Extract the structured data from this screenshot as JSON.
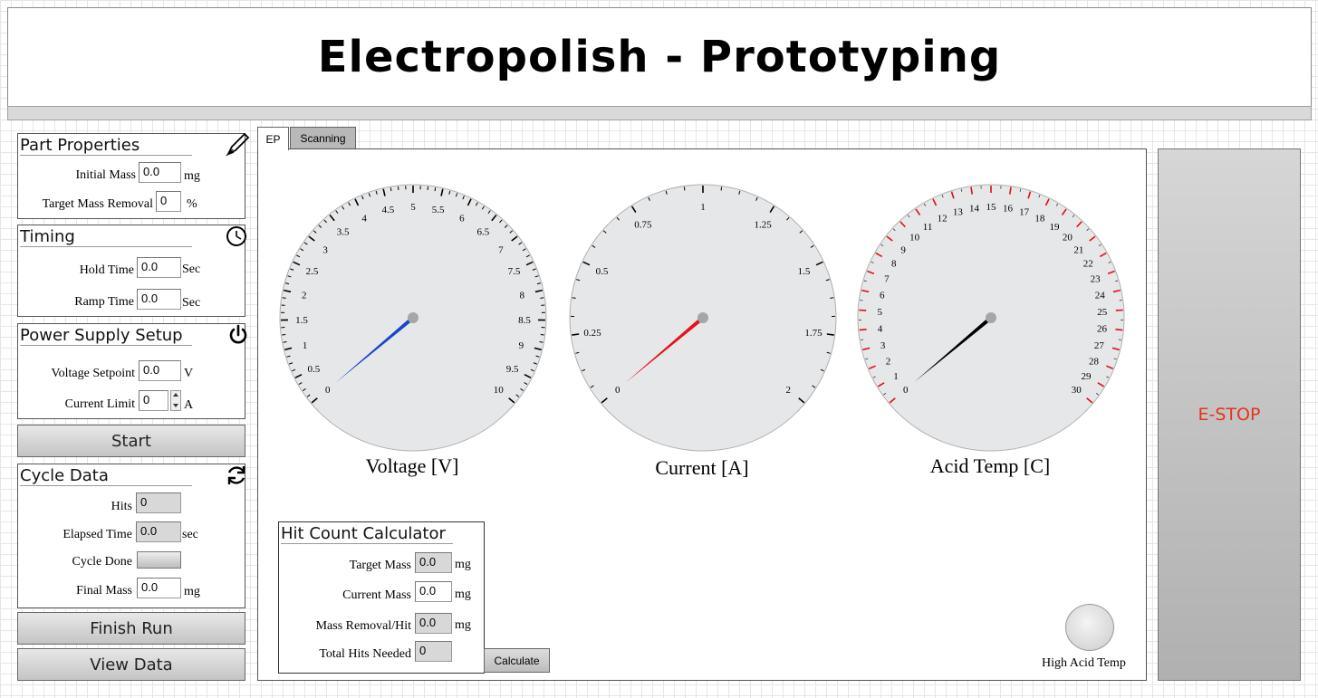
{
  "title": "Electropolish - Prototyping",
  "part_properties": {
    "title": "Part Properties",
    "initial_mass": {
      "label": "Initial Mass",
      "value": "0.0",
      "unit": "mg"
    },
    "target_removal": {
      "label": "Target Mass Removal",
      "value": "0",
      "unit": "%"
    }
  },
  "timing": {
    "title": "Timing",
    "hold_time": {
      "label": "Hold Time",
      "value": "0.0",
      "unit": "Sec"
    },
    "ramp_time": {
      "label": "Ramp Time",
      "value": "0.0",
      "unit": "Sec"
    }
  },
  "power_supply": {
    "title": "Power Supply Setup",
    "voltage": {
      "label": "Voltage Setpoint",
      "value": "0.0",
      "unit": "V"
    },
    "current": {
      "label": "Current Limit",
      "value": "0",
      "unit": "A"
    }
  },
  "start_label": "Start",
  "cycle_data": {
    "title": "Cycle Data",
    "hits": {
      "label": "Hits",
      "value": "0"
    },
    "elapsed": {
      "label": "Elapsed Time",
      "value": "0.0",
      "unit": "sec"
    },
    "cycle_done": {
      "label": "Cycle Done"
    },
    "final_mass": {
      "label": "Final Mass",
      "value": "0.0",
      "unit": "mg"
    }
  },
  "finish_label": "Finish Run",
  "view_label": "View Data",
  "tabs": [
    "EP",
    "Scanning"
  ],
  "gauges": [
    {
      "label": "Voltage [V]",
      "value": 0,
      "needle_color": "#1b45c8",
      "ticks": [
        "0",
        "0.5",
        "1",
        "1.5",
        "2",
        "2.5",
        "3",
        "3.5",
        "4",
        "4.5",
        "5",
        "5.5",
        "6",
        "6.5",
        "7",
        "7.5",
        "8",
        "8.5",
        "9",
        "9.5",
        "10"
      ]
    },
    {
      "label": "Current [A]",
      "value": 0,
      "needle_color": "#e8101a",
      "ticks": [
        "0",
        "0.25",
        "0.5",
        "0.75",
        "1",
        "1.25",
        "1.5",
        "1.75",
        "2"
      ]
    },
    {
      "label": "Acid Temp [C]",
      "value": 0,
      "needle_color": "#000000",
      "ticks": [
        "0",
        "1",
        "2",
        "3",
        "4",
        "5",
        "6",
        "7",
        "8",
        "9",
        "10",
        "11",
        "12",
        "13",
        "14",
        "15",
        "16",
        "17",
        "18",
        "19",
        "20",
        "21",
        "22",
        "23",
        "24",
        "25",
        "26",
        "27",
        "28",
        "29",
        "30"
      ]
    }
  ],
  "estop_label": "E-STOP",
  "hit_calc": {
    "title": "Hit Count Calculator",
    "target_mass": {
      "label": "Target Mass",
      "value": "0.0",
      "unit": "mg"
    },
    "current_mass": {
      "label": "Current Mass",
      "value": "0.0",
      "unit": "mg"
    },
    "removal_per_hit": {
      "label": "Mass Removal/Hit",
      "value": "0.0",
      "unit": "mg"
    },
    "total_hits": {
      "label": "Total Hits Needed",
      "value": "0"
    }
  },
  "calculate_label": "Calculate",
  "led_label": "High Acid Temp",
  "colors": {
    "estop_text": "#e8321c",
    "temp_red_ticks": "#e01010"
  }
}
